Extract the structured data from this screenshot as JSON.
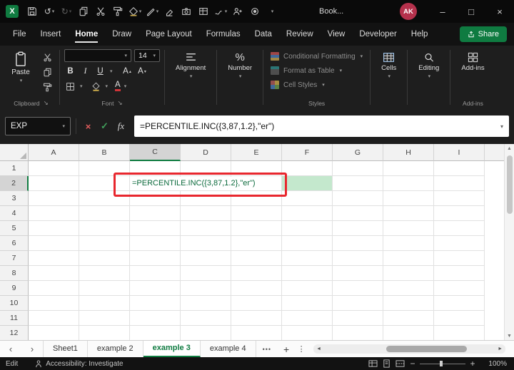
{
  "titlebar": {
    "title": "Book...",
    "avatar_initials": "AK"
  },
  "menubar": {
    "tabs": [
      "File",
      "Insert",
      "Home",
      "Draw",
      "Page Layout",
      "Formulas",
      "Data",
      "Review",
      "View",
      "Developer",
      "Help"
    ],
    "active_tab": "Home",
    "share_label": "Share"
  },
  "ribbon": {
    "paste_label": "Paste",
    "clipboard_label": "Clipboard",
    "font_size": "14",
    "bold": "B",
    "italic": "I",
    "underline": "U",
    "letter_a": "A",
    "font_label": "Font",
    "alignment_label": "Alignment",
    "number_label": "Number",
    "styles": {
      "conditional_formatting": "Conditional Formatting",
      "format_as_table": "Format as Table",
      "cell_styles": "Cell Styles",
      "label": "Styles"
    },
    "cells_label": "Cells",
    "editing_label": "Editing",
    "addins_label": "Add-ins"
  },
  "formula_bar": {
    "name_box": "EXP",
    "fx_label": "fx",
    "formula": "=PERCENTILE.INC({3,87,1.2},\"er\")"
  },
  "grid": {
    "columns": [
      "A",
      "B",
      "C",
      "D",
      "E",
      "F",
      "G",
      "H",
      "I"
    ],
    "rows": [
      "1",
      "2",
      "3",
      "4",
      "5",
      "6",
      "7",
      "8",
      "9",
      "10",
      "11",
      "12"
    ],
    "active_cell": "C2",
    "active_cell_text": "=PERCENTILE.INC({3,87,1.2},\"er\")"
  },
  "sheet_bar": {
    "tabs": [
      "Sheet1",
      "example 2",
      "example 3",
      "example 4"
    ],
    "active_tab": "example 3"
  },
  "status_bar": {
    "mode": "Edit",
    "accessibility": "Accessibility: Investigate",
    "zoom": "100%"
  },
  "icons": {
    "excel_x": "X",
    "undo": "↺",
    "redo": "↻",
    "dropdown": "▾",
    "tri_up": "▴",
    "tri_down": "▾",
    "minimize": "–",
    "maximize": "□",
    "close": "×",
    "cancel": "×",
    "enter": "✓",
    "percent": "%",
    "more_dots": "•••",
    "kebab": "⋮",
    "plus": "+",
    "minus": "−",
    "up_arrow": "▲",
    "down_arrow": "▼",
    "left_arrow": "◄",
    "right_arrow": "►",
    "tab_left": "‹",
    "tab_right": "›",
    "dialog_launcher": "↘"
  },
  "colors": {
    "accent_green": "#107c41",
    "annotation_red": "#e8272e",
    "cell_fill_green": "#c4e8cd",
    "avatar_red": "#b5314c",
    "font_color_red": "#d13438"
  }
}
